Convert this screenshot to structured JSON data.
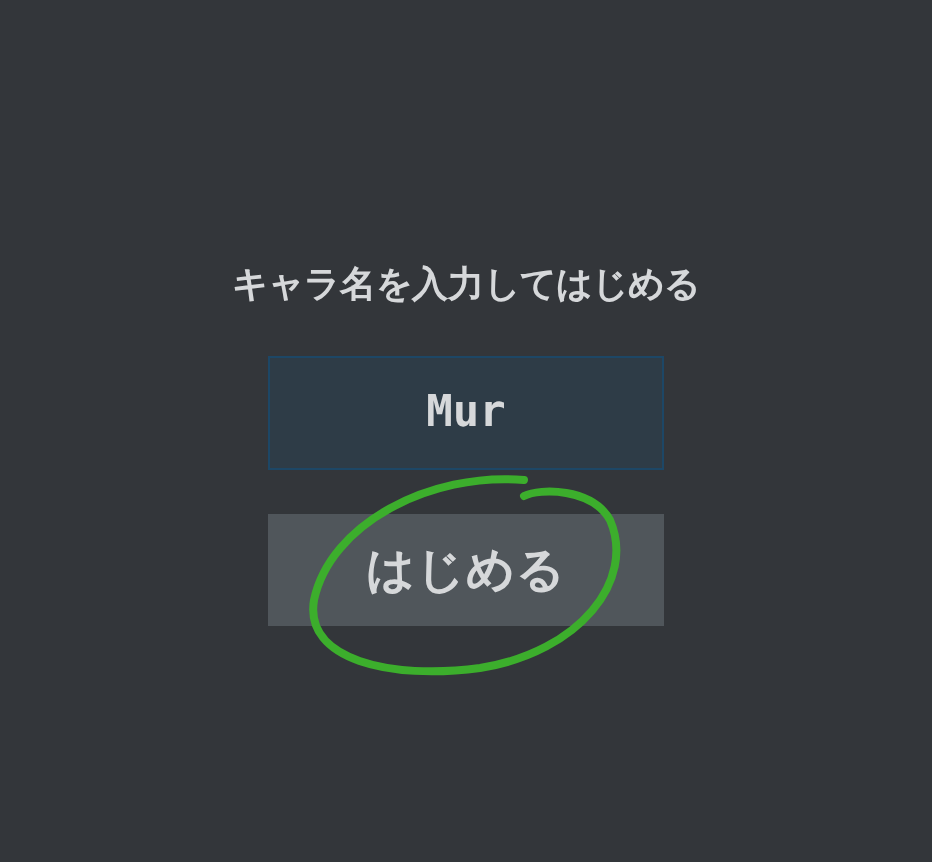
{
  "prompt": "キャラ名を入力してはじめる",
  "name_field": {
    "value": "Mur"
  },
  "start_button": {
    "label": "はじめる"
  }
}
